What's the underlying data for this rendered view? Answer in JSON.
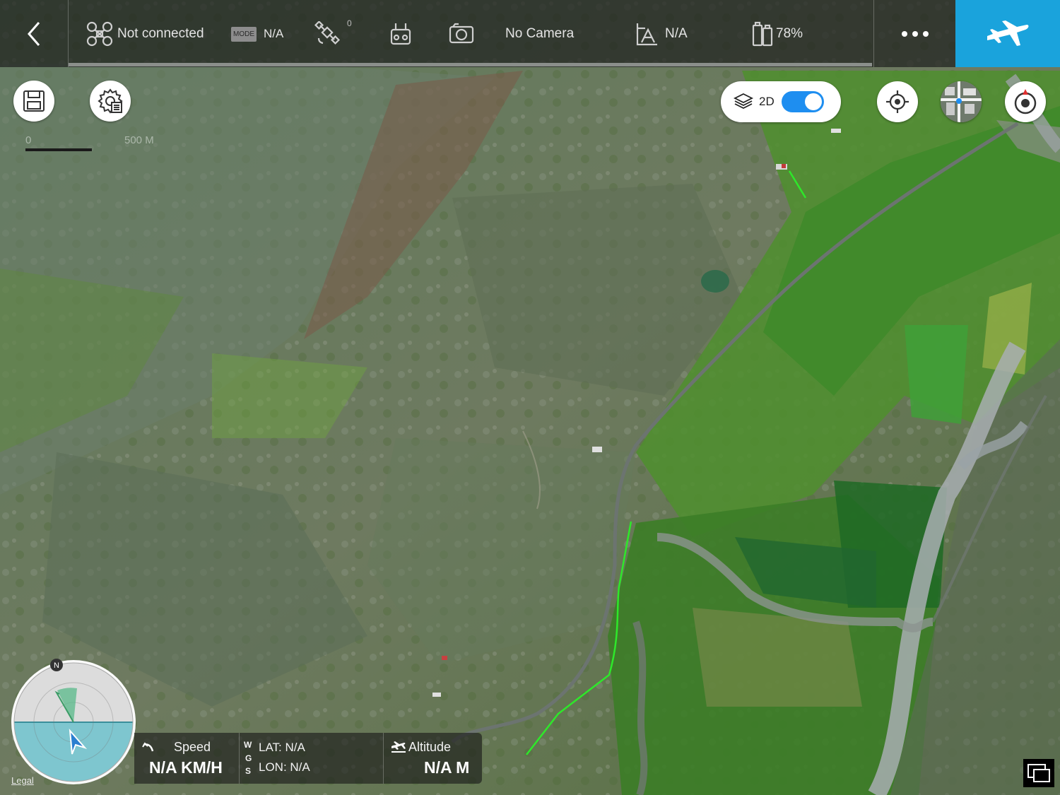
{
  "topbar": {
    "back_icon": "chevron-left-icon",
    "aircraft_status": "Not connected",
    "mode_badge": "MODE",
    "mode_value": "N/A",
    "satellite_count": "0",
    "camera_status": "No Camera",
    "flight_mode_value": "N/A",
    "battery": "78%",
    "more_icon": "more-dots-icon",
    "fly_icon": "airplane-icon",
    "fly_button_color": "#1aa3dc"
  },
  "map": {
    "view_mode_label": "2D",
    "view_mode_toggle_on": true,
    "scale_start": "0",
    "scale_end": "500 M",
    "legal": "Legal",
    "flight_path_color": "#2ee82a"
  },
  "radar": {
    "north": "N"
  },
  "telemetry": {
    "speed_label": "Speed",
    "speed_value": "N/A KM/H",
    "wgs_w": "W",
    "wgs_g": "G",
    "wgs_s": "S",
    "lat": "LAT: N/A",
    "lon": "LON: N/A",
    "altitude_label": "Altitude",
    "altitude_value": "N/A M"
  }
}
